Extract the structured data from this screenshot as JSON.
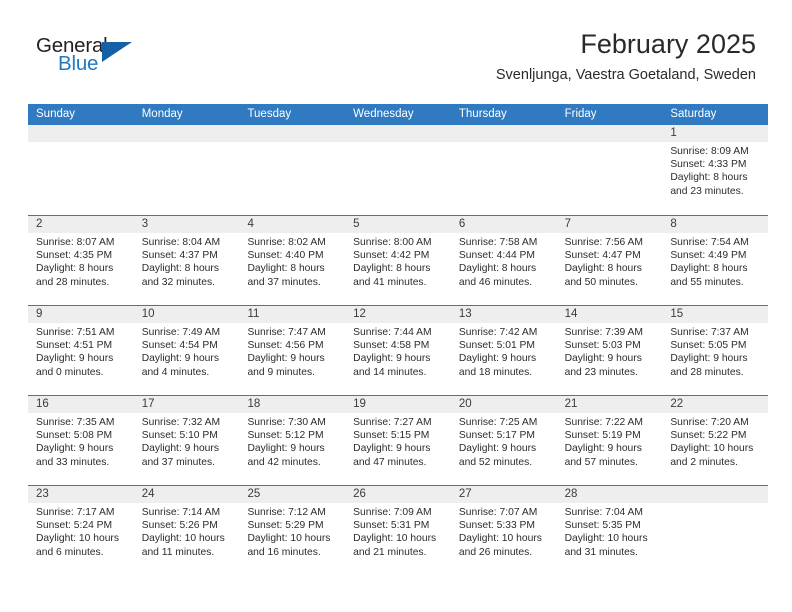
{
  "logo": {
    "word_one": "General",
    "word_two": "Blue",
    "triangle_color": "#1561a8",
    "blue_text_color": "#1f7ac4"
  },
  "header": {
    "month_title": "February 2025",
    "location": "Svenljunga, Vaestra Goetaland, Sweden"
  },
  "theme": {
    "header_blue": "#2f7ac0",
    "daynum_band_grey": "#eeeeee",
    "text_color": "#2c2c2c"
  },
  "weekdays": [
    "Sunday",
    "Monday",
    "Tuesday",
    "Wednesday",
    "Thursday",
    "Friday",
    "Saturday"
  ],
  "weeks": [
    [
      {
        "day": "",
        "sunrise": "",
        "sunset": "",
        "daylight_line1": "",
        "daylight_line2": "",
        "empty": true
      },
      {
        "day": "",
        "sunrise": "",
        "sunset": "",
        "daylight_line1": "",
        "daylight_line2": "",
        "empty": true
      },
      {
        "day": "",
        "sunrise": "",
        "sunset": "",
        "daylight_line1": "",
        "daylight_line2": "",
        "empty": true
      },
      {
        "day": "",
        "sunrise": "",
        "sunset": "",
        "daylight_line1": "",
        "daylight_line2": "",
        "empty": true
      },
      {
        "day": "",
        "sunrise": "",
        "sunset": "",
        "daylight_line1": "",
        "daylight_line2": "",
        "empty": true
      },
      {
        "day": "",
        "sunrise": "",
        "sunset": "",
        "daylight_line1": "",
        "daylight_line2": "",
        "empty": true
      },
      {
        "day": "1",
        "sunrise": "Sunrise: 8:09 AM",
        "sunset": "Sunset: 4:33 PM",
        "daylight_line1": "Daylight: 8 hours",
        "daylight_line2": "and 23 minutes.",
        "empty": false
      }
    ],
    [
      {
        "day": "2",
        "sunrise": "Sunrise: 8:07 AM",
        "sunset": "Sunset: 4:35 PM",
        "daylight_line1": "Daylight: 8 hours",
        "daylight_line2": "and 28 minutes.",
        "empty": false
      },
      {
        "day": "3",
        "sunrise": "Sunrise: 8:04 AM",
        "sunset": "Sunset: 4:37 PM",
        "daylight_line1": "Daylight: 8 hours",
        "daylight_line2": "and 32 minutes.",
        "empty": false
      },
      {
        "day": "4",
        "sunrise": "Sunrise: 8:02 AM",
        "sunset": "Sunset: 4:40 PM",
        "daylight_line1": "Daylight: 8 hours",
        "daylight_line2": "and 37 minutes.",
        "empty": false
      },
      {
        "day": "5",
        "sunrise": "Sunrise: 8:00 AM",
        "sunset": "Sunset: 4:42 PM",
        "daylight_line1": "Daylight: 8 hours",
        "daylight_line2": "and 41 minutes.",
        "empty": false
      },
      {
        "day": "6",
        "sunrise": "Sunrise: 7:58 AM",
        "sunset": "Sunset: 4:44 PM",
        "daylight_line1": "Daylight: 8 hours",
        "daylight_line2": "and 46 minutes.",
        "empty": false
      },
      {
        "day": "7",
        "sunrise": "Sunrise: 7:56 AM",
        "sunset": "Sunset: 4:47 PM",
        "daylight_line1": "Daylight: 8 hours",
        "daylight_line2": "and 50 minutes.",
        "empty": false
      },
      {
        "day": "8",
        "sunrise": "Sunrise: 7:54 AM",
        "sunset": "Sunset: 4:49 PM",
        "daylight_line1": "Daylight: 8 hours",
        "daylight_line2": "and 55 minutes.",
        "empty": false
      }
    ],
    [
      {
        "day": "9",
        "sunrise": "Sunrise: 7:51 AM",
        "sunset": "Sunset: 4:51 PM",
        "daylight_line1": "Daylight: 9 hours",
        "daylight_line2": "and 0 minutes.",
        "empty": false
      },
      {
        "day": "10",
        "sunrise": "Sunrise: 7:49 AM",
        "sunset": "Sunset: 4:54 PM",
        "daylight_line1": "Daylight: 9 hours",
        "daylight_line2": "and 4 minutes.",
        "empty": false
      },
      {
        "day": "11",
        "sunrise": "Sunrise: 7:47 AM",
        "sunset": "Sunset: 4:56 PM",
        "daylight_line1": "Daylight: 9 hours",
        "daylight_line2": "and 9 minutes.",
        "empty": false
      },
      {
        "day": "12",
        "sunrise": "Sunrise: 7:44 AM",
        "sunset": "Sunset: 4:58 PM",
        "daylight_line1": "Daylight: 9 hours",
        "daylight_line2": "and 14 minutes.",
        "empty": false
      },
      {
        "day": "13",
        "sunrise": "Sunrise: 7:42 AM",
        "sunset": "Sunset: 5:01 PM",
        "daylight_line1": "Daylight: 9 hours",
        "daylight_line2": "and 18 minutes.",
        "empty": false
      },
      {
        "day": "14",
        "sunrise": "Sunrise: 7:39 AM",
        "sunset": "Sunset: 5:03 PM",
        "daylight_line1": "Daylight: 9 hours",
        "daylight_line2": "and 23 minutes.",
        "empty": false
      },
      {
        "day": "15",
        "sunrise": "Sunrise: 7:37 AM",
        "sunset": "Sunset: 5:05 PM",
        "daylight_line1": "Daylight: 9 hours",
        "daylight_line2": "and 28 minutes.",
        "empty": false
      }
    ],
    [
      {
        "day": "16",
        "sunrise": "Sunrise: 7:35 AM",
        "sunset": "Sunset: 5:08 PM",
        "daylight_line1": "Daylight: 9 hours",
        "daylight_line2": "and 33 minutes.",
        "empty": false
      },
      {
        "day": "17",
        "sunrise": "Sunrise: 7:32 AM",
        "sunset": "Sunset: 5:10 PM",
        "daylight_line1": "Daylight: 9 hours",
        "daylight_line2": "and 37 minutes.",
        "empty": false
      },
      {
        "day": "18",
        "sunrise": "Sunrise: 7:30 AM",
        "sunset": "Sunset: 5:12 PM",
        "daylight_line1": "Daylight: 9 hours",
        "daylight_line2": "and 42 minutes.",
        "empty": false
      },
      {
        "day": "19",
        "sunrise": "Sunrise: 7:27 AM",
        "sunset": "Sunset: 5:15 PM",
        "daylight_line1": "Daylight: 9 hours",
        "daylight_line2": "and 47 minutes.",
        "empty": false
      },
      {
        "day": "20",
        "sunrise": "Sunrise: 7:25 AM",
        "sunset": "Sunset: 5:17 PM",
        "daylight_line1": "Daylight: 9 hours",
        "daylight_line2": "and 52 minutes.",
        "empty": false
      },
      {
        "day": "21",
        "sunrise": "Sunrise: 7:22 AM",
        "sunset": "Sunset: 5:19 PM",
        "daylight_line1": "Daylight: 9 hours",
        "daylight_line2": "and 57 minutes.",
        "empty": false
      },
      {
        "day": "22",
        "sunrise": "Sunrise: 7:20 AM",
        "sunset": "Sunset: 5:22 PM",
        "daylight_line1": "Daylight: 10 hours",
        "daylight_line2": "and 2 minutes.",
        "empty": false
      }
    ],
    [
      {
        "day": "23",
        "sunrise": "Sunrise: 7:17 AM",
        "sunset": "Sunset: 5:24 PM",
        "daylight_line1": "Daylight: 10 hours",
        "daylight_line2": "and 6 minutes.",
        "empty": false
      },
      {
        "day": "24",
        "sunrise": "Sunrise: 7:14 AM",
        "sunset": "Sunset: 5:26 PM",
        "daylight_line1": "Daylight: 10 hours",
        "daylight_line2": "and 11 minutes.",
        "empty": false
      },
      {
        "day": "25",
        "sunrise": "Sunrise: 7:12 AM",
        "sunset": "Sunset: 5:29 PM",
        "daylight_line1": "Daylight: 10 hours",
        "daylight_line2": "and 16 minutes.",
        "empty": false
      },
      {
        "day": "26",
        "sunrise": "Sunrise: 7:09 AM",
        "sunset": "Sunset: 5:31 PM",
        "daylight_line1": "Daylight: 10 hours",
        "daylight_line2": "and 21 minutes.",
        "empty": false
      },
      {
        "day": "27",
        "sunrise": "Sunrise: 7:07 AM",
        "sunset": "Sunset: 5:33 PM",
        "daylight_line1": "Daylight: 10 hours",
        "daylight_line2": "and 26 minutes.",
        "empty": false
      },
      {
        "day": "28",
        "sunrise": "Sunrise: 7:04 AM",
        "sunset": "Sunset: 5:35 PM",
        "daylight_line1": "Daylight: 10 hours",
        "daylight_line2": "and 31 minutes.",
        "empty": false
      },
      {
        "day": "",
        "sunrise": "",
        "sunset": "",
        "daylight_line1": "",
        "daylight_line2": "",
        "empty": true
      }
    ]
  ]
}
